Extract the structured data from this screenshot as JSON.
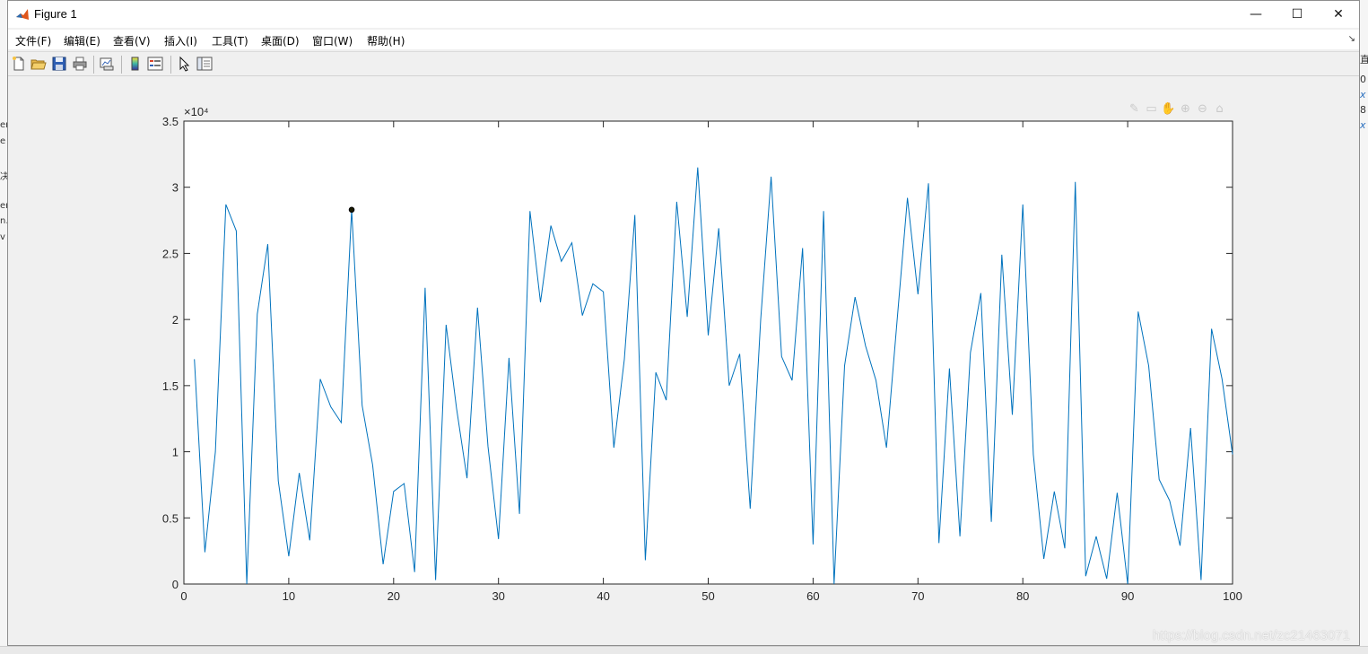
{
  "window": {
    "title": "Figure 1",
    "controls": {
      "minimize": "—",
      "maximize": "☐",
      "close": "✕"
    }
  },
  "menu": [
    {
      "label": "文件(F)"
    },
    {
      "label": "编辑(E)"
    },
    {
      "label": "查看(V)"
    },
    {
      "label": "插入(I)"
    },
    {
      "label": "工具(T)"
    },
    {
      "label": "桌面(D)"
    },
    {
      "label": "窗口(W)"
    },
    {
      "label": "帮助(H)"
    }
  ],
  "toolbar": {
    "icons": [
      "new-figure-icon",
      "open-file-icon",
      "save-icon",
      "print-icon",
      "link-plot-icon",
      "insert-colorbar-icon",
      "insert-legend-icon",
      "edit-plot-pointer-icon",
      "property-inspector-icon"
    ]
  },
  "axes_toolbar": {
    "icons": [
      "brush-icon",
      "data-tips-icon",
      "pan-icon",
      "zoom-in-icon",
      "zoom-out-icon",
      "home-icon"
    ]
  },
  "watermark": "https://blog.csdn.net/zc21463071",
  "colors": {
    "line": "#0072BD",
    "marker": "#1a1a00",
    "axes_bg": "#ffffff",
    "figure_bg": "#f0f0f0"
  },
  "chart_data": {
    "type": "line",
    "title": "",
    "xlabel": "",
    "ylabel": "",
    "xlim": [
      0,
      100
    ],
    "ylim": [
      0,
      35000
    ],
    "y_exponent_label": "×10⁴",
    "xticks": [
      0,
      10,
      20,
      30,
      40,
      50,
      60,
      70,
      80,
      90,
      100
    ],
    "xtick_labels": [
      "0",
      "10",
      "20",
      "30",
      "40",
      "50",
      "60",
      "70",
      "80",
      "90",
      "100"
    ],
    "yticks": [
      0,
      5000,
      10000,
      15000,
      20000,
      25000,
      30000,
      35000
    ],
    "ytick_labels": [
      "0",
      "0.5",
      "1",
      "1.5",
      "2",
      "2.5",
      "3",
      "3.5"
    ],
    "grid": false,
    "series": [
      {
        "x": [
          1,
          2,
          3,
          4,
          5,
          6,
          7,
          8,
          9,
          10,
          11,
          12,
          13,
          14,
          15,
          16,
          17,
          18,
          19,
          20,
          21,
          22,
          23,
          24,
          25,
          26,
          27,
          28,
          29,
          30,
          31,
          32,
          33,
          34,
          35,
          36,
          37,
          38,
          39,
          40,
          41,
          42,
          43,
          44,
          45,
          46,
          47,
          48,
          49,
          50,
          51,
          52,
          53,
          54,
          55,
          56,
          57,
          58,
          59,
          60,
          61,
          62,
          63,
          64,
          65,
          66,
          67,
          68,
          69,
          70,
          71,
          72,
          73,
          74,
          75,
          76,
          77,
          78,
          79,
          80,
          81,
          82,
          83,
          84,
          85,
          86,
          87,
          88,
          89,
          90,
          91,
          92,
          93,
          94,
          95,
          96,
          97,
          98,
          99,
          100
        ],
        "y": [
          17000,
          2400,
          10000,
          28700,
          26700,
          0,
          20400,
          25700,
          7800,
          2100,
          8400,
          3300,
          15500,
          13400,
          12200,
          28300,
          13500,
          9000,
          1500,
          7000,
          7600,
          900,
          22400,
          300,
          19600,
          13300,
          8000,
          20900,
          10400,
          3400,
          17100,
          5300,
          28200,
          21300,
          27100,
          24400,
          25800,
          20300,
          22700,
          22100,
          10300,
          17000,
          27900,
          1800,
          16000,
          13900,
          28900,
          20200,
          31500,
          18800,
          26900,
          15000,
          17400,
          5700,
          20000,
          30800,
          17200,
          15400,
          25400,
          3000,
          28200,
          0,
          16500,
          21700,
          18000,
          15400,
          10300,
          19800,
          29200,
          21900,
          30300,
          3100,
          16300,
          3600,
          17500,
          22000,
          4700,
          24900,
          12800,
          28700,
          9800,
          1900,
          7000,
          2700,
          30400,
          600,
          3600,
          400,
          6900,
          0,
          20600,
          16500,
          7900,
          6300,
          2900,
          11800,
          300,
          19300,
          15500,
          9800
        ]
      }
    ],
    "highlighted_point": {
      "x": 16,
      "y": 28300
    }
  }
}
